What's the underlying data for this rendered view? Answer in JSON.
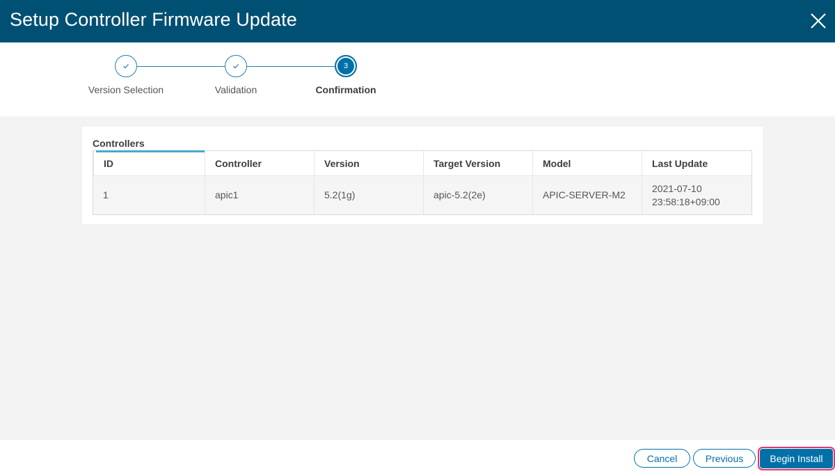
{
  "dialog": {
    "title": "Setup Controller Firmware Update",
    "close_icon": "close-icon"
  },
  "stepper": {
    "steps": [
      {
        "label": "Version Selection",
        "status": "completed",
        "icon": "check-icon"
      },
      {
        "label": "Validation",
        "status": "completed",
        "icon": "check-icon"
      },
      {
        "label": "Confirmation",
        "status": "active",
        "number": "3"
      }
    ]
  },
  "controllers": {
    "section_title": "Controllers",
    "columns": [
      "ID",
      "Controller",
      "Version",
      "Target Version",
      "Model",
      "Last Update"
    ],
    "rows": [
      {
        "id": "1",
        "controller": "apic1",
        "version": "5.2(1g)",
        "target_version": "apic-5.2(2e)",
        "model": "APIC-SERVER-M2",
        "last_update_date": "2021-07-10",
        "last_update_time": "23:58:18+09:00"
      }
    ]
  },
  "footer": {
    "cancel_label": "Cancel",
    "previous_label": "Previous",
    "begin_install_label": "Begin Install"
  },
  "colors": {
    "header_bg": "#005073",
    "accent": "#0071a8",
    "highlight_border": "#e8326a"
  }
}
